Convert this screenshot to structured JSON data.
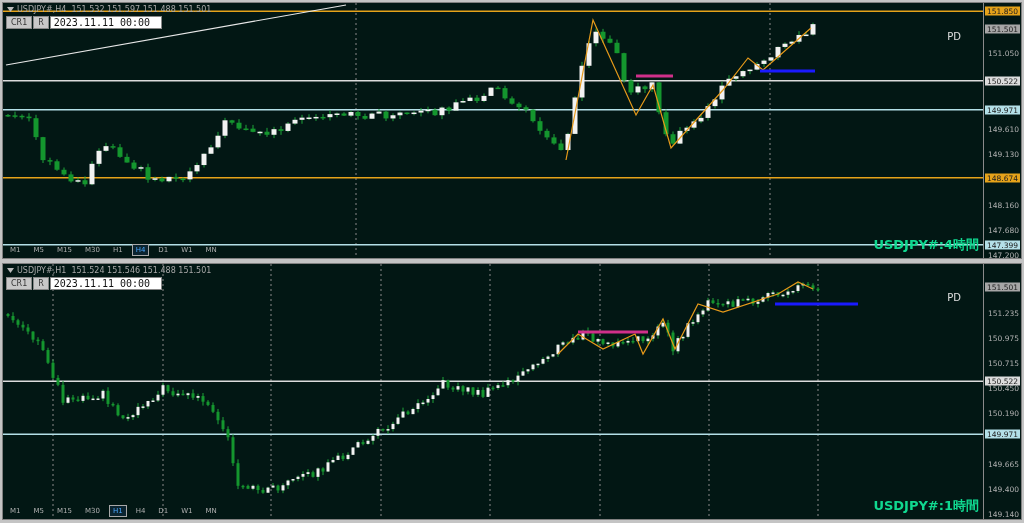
{
  "panels": [
    {
      "header": "USDJPY#,H4  151.532 151.597 151.488 151.501",
      "buttons": [
        "CR1",
        "R"
      ],
      "date": "2023.11.11 00:00",
      "marker": "PD",
      "title": "USDJPY#:4時間",
      "ticks": [
        "151.050",
        "149.610",
        "149.130",
        "148.160",
        "147.680",
        "147.200"
      ],
      "levels": [
        {
          "kind": "line",
          "price": "151.850",
          "color": "#e6a31a"
        },
        {
          "kind": "bid",
          "price": "151.501",
          "color": "#a6a6a6"
        },
        {
          "kind": "line",
          "price": "150.522",
          "color": "#dcdcdc"
        },
        {
          "kind": "line",
          "price": "149.971",
          "color": "#b4e0e8"
        },
        {
          "kind": "line",
          "price": "148.674",
          "color": "#e6a31a"
        },
        {
          "kind": "line",
          "price": "147.399",
          "color": "#b4e0e8"
        }
      ],
      "timeframes": [
        {
          "label": "M1",
          "selected": false
        },
        {
          "label": "M5",
          "selected": false
        },
        {
          "label": "M15",
          "selected": false
        },
        {
          "label": "M30",
          "selected": false
        },
        {
          "label": "H1",
          "selected": false
        },
        {
          "label": "H4",
          "selected": true
        },
        {
          "label": "D1",
          "selected": false
        },
        {
          "label": "W1",
          "selected": false
        },
        {
          "label": "MN",
          "selected": false
        }
      ]
    },
    {
      "header": "USDJPY#,H1  151.524 151.546 151.488 151.501",
      "buttons": [
        "CR1",
        "R"
      ],
      "date": "2023.11.11 00:00",
      "marker": "PD",
      "title": "USDJPY#:1時間",
      "ticks": [
        "151.235",
        "150.975",
        "150.715",
        "150.450",
        "150.190",
        "149.665",
        "149.400",
        "149.140"
      ],
      "levels": [
        {
          "kind": "bid",
          "price": "151.501",
          "color": "#a6a6a6"
        },
        {
          "kind": "line",
          "price": "150.522",
          "color": "#dcdcdc"
        },
        {
          "kind": "line",
          "price": "149.971",
          "color": "#b4e0e8"
        }
      ],
      "timeframes": [
        {
          "label": "M1",
          "selected": false
        },
        {
          "label": "M5",
          "selected": false
        },
        {
          "label": "M15",
          "selected": false
        },
        {
          "label": "M30",
          "selected": false
        },
        {
          "label": "H1",
          "selected": true
        },
        {
          "label": "H4",
          "selected": false
        },
        {
          "label": "D1",
          "selected": false
        },
        {
          "label": "W1",
          "selected": false
        },
        {
          "label": "MN",
          "selected": false
        }
      ]
    }
  ]
}
